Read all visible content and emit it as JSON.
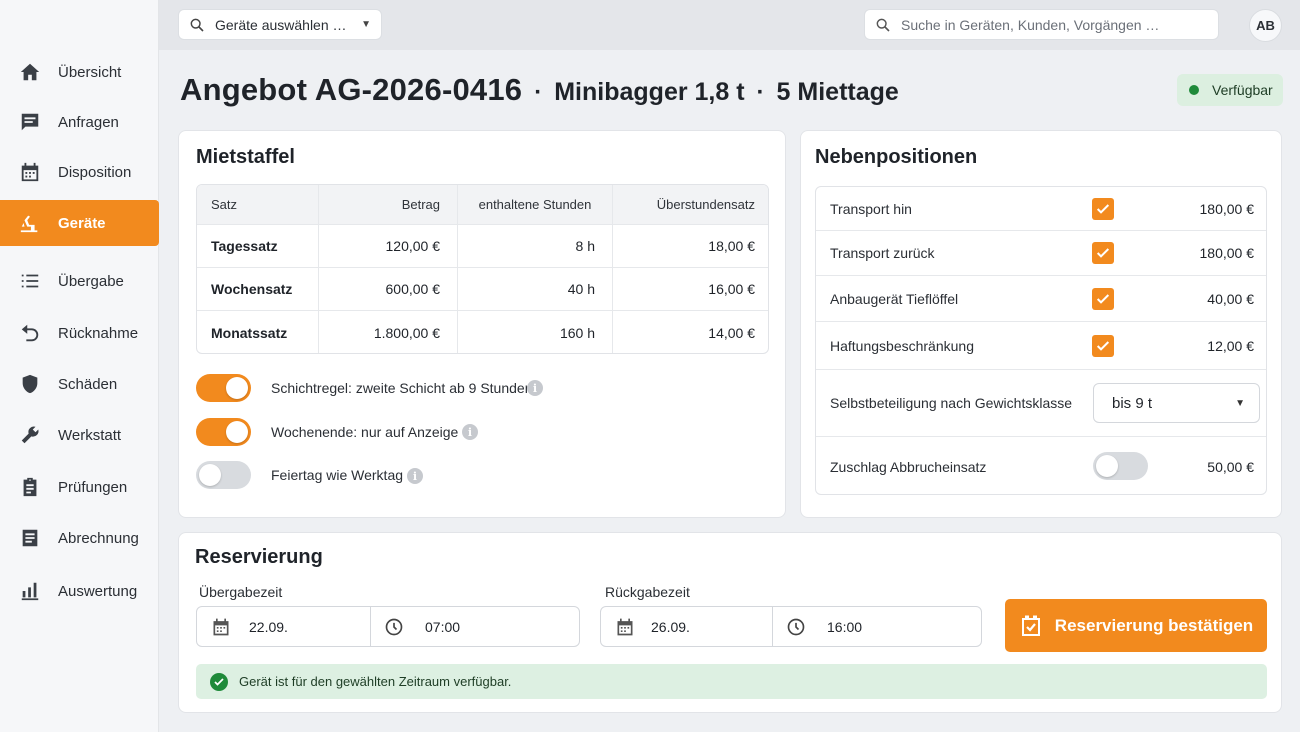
{
  "nav": {
    "items": [
      {
        "label": "Übersicht",
        "icon": "home-icon"
      },
      {
        "label": "Anfragen",
        "icon": "message-icon"
      },
      {
        "label": "Disposition",
        "icon": "calendar-icon"
      },
      {
        "label": "Geräte",
        "icon": "excavator-icon",
        "active": true
      },
      {
        "label": "Übergabe",
        "icon": "list-icon"
      },
      {
        "label": "Rücknahme",
        "icon": "undo-icon"
      },
      {
        "label": "Schäden",
        "icon": "shield-icon"
      },
      {
        "label": "Werkstatt",
        "icon": "wrench-icon"
      },
      {
        "label": "Prüfungen",
        "icon": "clipboard-icon"
      },
      {
        "label": "Abrechnung",
        "icon": "document-icon"
      },
      {
        "label": "Auswertung",
        "icon": "bar-chart-icon"
      }
    ]
  },
  "topbar": {
    "device_select": "Geräte auswählen …",
    "search_placeholder": "Suche in Geräten, Kunden, Vorgängen …",
    "avatar": "AB"
  },
  "header": {
    "title": "Angebot AG-2026-0416",
    "separator": "·",
    "machine": "Minibagger 1,8 t",
    "duration": "5 Miettage",
    "status": "Verfügbar"
  },
  "staffel": {
    "title": "Mietstaffel",
    "columns": [
      "Satz",
      "Betrag",
      "enthaltene Stunden",
      "Überstundensatz"
    ],
    "rows": [
      {
        "satz": "Tagessatz",
        "betrag": "120,00 €",
        "stunden": "8 h",
        "ueber": "18,00 €"
      },
      {
        "satz": "Wochensatz",
        "betrag": "600,00 €",
        "stunden": "40 h",
        "ueber": "16,00 €"
      },
      {
        "satz": "Monatssatz",
        "betrag": "1.800,00 €",
        "stunden": "160 h",
        "ueber": "14,00 €"
      }
    ],
    "options": [
      {
        "label": "Schichtregel: zweite Schicht ab 9 Stunden",
        "on": true
      },
      {
        "label": "Wochenende: nur auf Anzeige",
        "on": true
      },
      {
        "label": "Feiertag wie Werktag",
        "on": false
      }
    ]
  },
  "neben": {
    "title": "Nebenpositionen",
    "items": [
      {
        "label": "Transport hin",
        "checked": true,
        "amount": "180,00 €"
      },
      {
        "label": "Transport zurück",
        "checked": true,
        "amount": "180,00 €"
      },
      {
        "label": "Anbaugerät Tieflöffel",
        "checked": true,
        "amount": "40,00 €"
      },
      {
        "label": "Haftungsbeschränkung",
        "checked": true,
        "amount": "12,00 €"
      }
    ],
    "selbst": {
      "label": "Selbstbeteiligung nach Gewichtsklasse",
      "value": "bis 9 t"
    },
    "zuschlag": {
      "label": "Zuschlag Abbrucheinsatz",
      "on": false,
      "amount": "50,00 €"
    }
  },
  "reservierung": {
    "title": "Reservierung",
    "uebergabe_label": "Übergabezeit",
    "uebergabe_date": "22.09.",
    "uebergabe_time": "07:00",
    "rueckgabe_label": "Rückgabezeit",
    "rueckgabe_date": "26.09.",
    "rueckgabe_time": "16:00",
    "confirm_label": "Reservierung bestätigen",
    "notice": "Gerät ist für den gewählten Zeitraum verfügbar."
  },
  "colors": {
    "accent": "#f28a1e",
    "success": "#1f8a3a",
    "success_bg": "#ddf0e2"
  }
}
